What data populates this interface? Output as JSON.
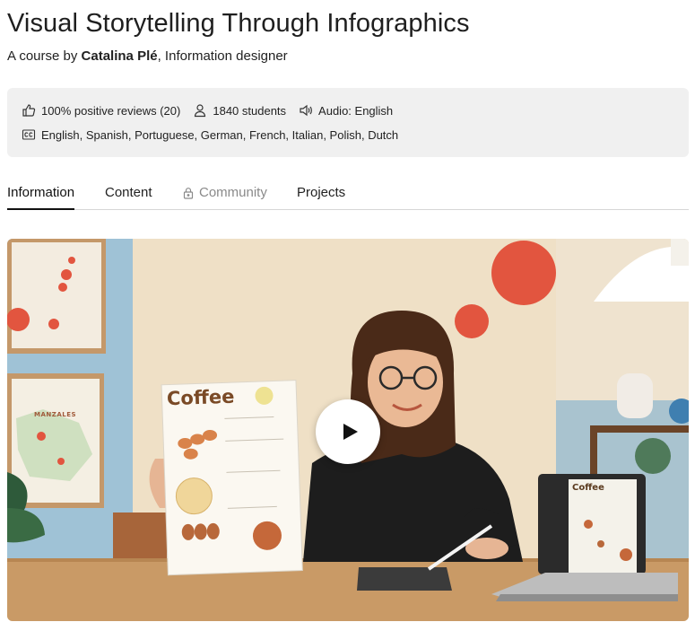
{
  "course": {
    "title": "Visual Storytelling Through Infographics",
    "byline_prefix": "A course by ",
    "author": "Catalina Plé",
    "author_role": ", Information designer"
  },
  "info": {
    "reviews": "100% positive reviews (20)",
    "students": "1840 students",
    "audio": "Audio: English",
    "subtitles": "English, Spanish, Portuguese, German, French, Italian, Polish, Dutch",
    "icons": [
      "thumbs-up-icon",
      "user-icon",
      "audio-icon",
      "captions-icon"
    ]
  },
  "tabs": [
    {
      "label": "Information",
      "active": true
    },
    {
      "label": "Content",
      "active": false
    },
    {
      "label": "Community",
      "locked": true
    },
    {
      "label": "Projects",
      "active": false
    }
  ],
  "video": {
    "poster_text": "Coffee",
    "laptop_text": "Coffee",
    "map_text": "MANZALES",
    "play_icon": "play-icon"
  },
  "colors": {
    "accent_red": "#e2553f",
    "wall_cream": "#efe0c6",
    "wall_blue": "#9fc2d6",
    "table_wood": "#c99a66"
  }
}
